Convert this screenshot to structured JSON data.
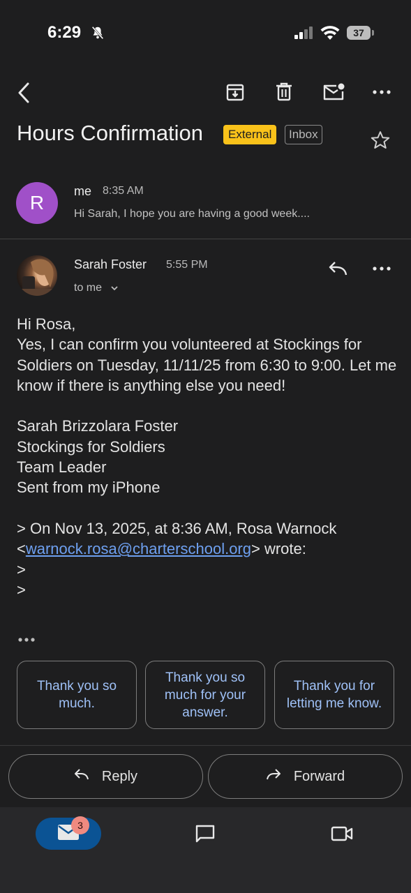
{
  "status_bar": {
    "time": "6:29",
    "battery": "37"
  },
  "email": {
    "subject": "Hours Confirmation",
    "labels": {
      "external": "External",
      "inbox": "Inbox"
    }
  },
  "thread": {
    "first": {
      "avatar_letter": "R",
      "sender": "me",
      "time": "8:35 AM",
      "snippet": "Hi Sarah, I hope you are having a good week...."
    },
    "second": {
      "sender": "Sarah Foster",
      "time": "5:55 PM",
      "recipients": "to me",
      "body": {
        "greeting": "Hi Rosa,",
        "message": "Yes, I can confirm you volunteered at Stockings for Soldiers on Tuesday, 11/11/25 from 6:30 to 9:00. Let me know if there is anything else you need!",
        "sig_name": "Sarah Brizzolara Foster",
        "sig_org": "Stockings for Soldiers",
        "sig_title": "Team Leader",
        "sig_device": "Sent from my iPhone",
        "quote_prefix": "> On Nov 13, 2025, at 8:36 AM, Rosa Warnock",
        "quote_email": "warnock.rosa@charterschool.org",
        "quote_suffix": "> wrote:",
        "quote_line1": ">",
        "quote_line2": ">"
      }
    }
  },
  "smart_replies": [
    "Thank you so much.",
    "Thank you so much for your answer.",
    "Thank you for letting me know."
  ],
  "actions": {
    "reply": "Reply",
    "forward": "Forward"
  },
  "bottom_nav": {
    "mail_badge": "3"
  },
  "colors": {
    "background": "#1e1e1f",
    "external_badge": "#f9c21a",
    "link": "#6ea0f0",
    "smart_reply_text": "#9fc1f7",
    "active_nav": "#0b5394",
    "avatar_r": "#a050c8"
  }
}
